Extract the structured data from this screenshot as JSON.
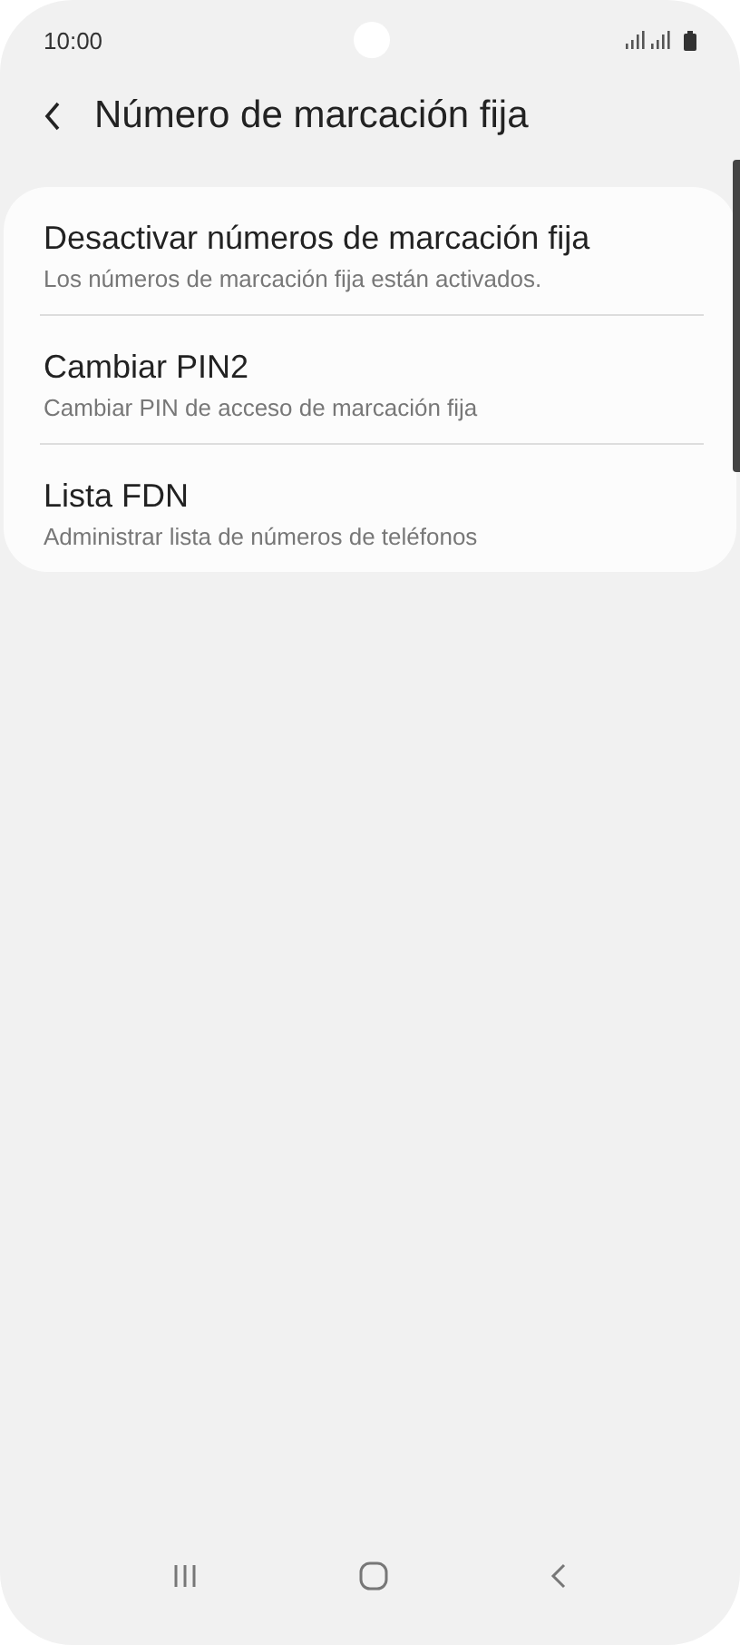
{
  "status_bar": {
    "time": "10:00"
  },
  "header": {
    "title": "Número de marcación fija"
  },
  "items": [
    {
      "title": "Desactivar números de marcación fija",
      "subtitle": "Los números de marcación fija están activados."
    },
    {
      "title": "Cambiar PIN2",
      "subtitle": "Cambiar PIN de acceso de marcación fija"
    },
    {
      "title": "Lista FDN",
      "subtitle": "Administrar lista de números de teléfonos"
    }
  ]
}
